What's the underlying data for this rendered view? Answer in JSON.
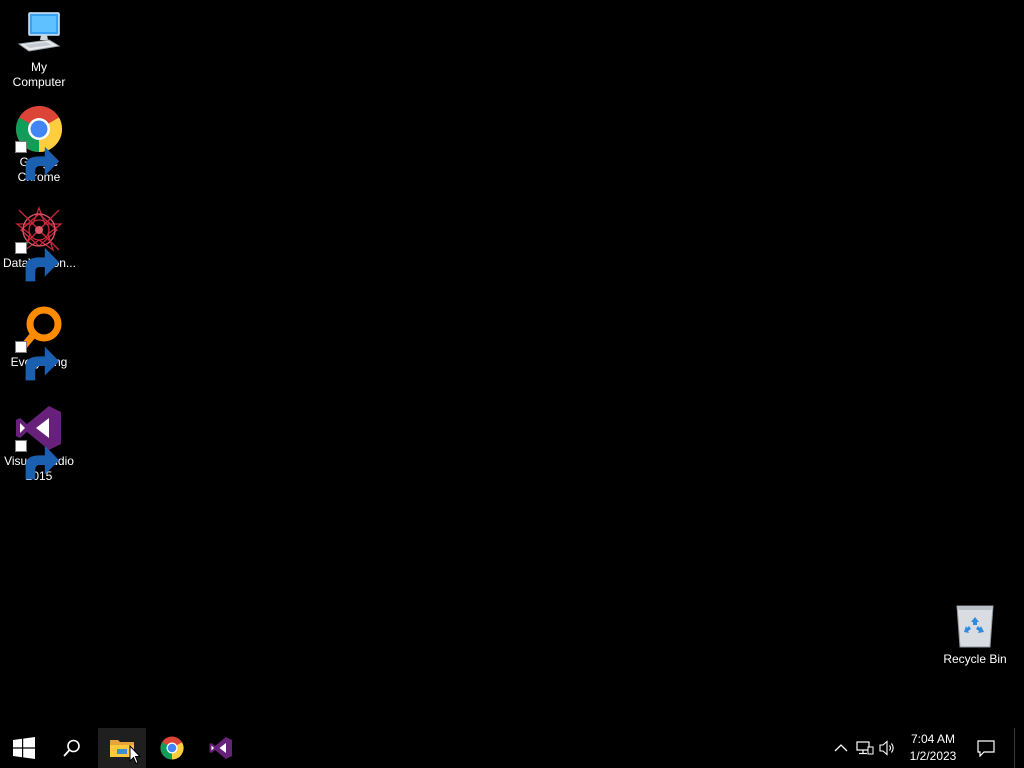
{
  "desktop": {
    "icons": [
      {
        "label": "My Computer",
        "icon": "computer-icon"
      },
      {
        "label": "Google Chrome",
        "icon": "chrome-icon",
        "shortcut": true
      },
      {
        "label": "DataWagon...",
        "icon": "datawagon-icon",
        "shortcut": true
      },
      {
        "label": "Everything",
        "icon": "everything-search-icon",
        "shortcut": true
      },
      {
        "label": "Visual Studio 2015",
        "icon": "visual-studio-icon",
        "shortcut": true
      },
      {
        "label": "Recycle Bin",
        "icon": "recycle-bin-icon"
      }
    ]
  },
  "taskbar": {
    "buttons": [
      {
        "name": "start",
        "icon": "windows-logo-icon"
      },
      {
        "name": "search",
        "icon": "search-icon"
      },
      {
        "name": "file-explorer",
        "icon": "folder-icon",
        "active": true
      },
      {
        "name": "chrome",
        "icon": "chrome-icon"
      },
      {
        "name": "visual-studio",
        "icon": "visual-studio-icon"
      }
    ],
    "tray": {
      "icons": [
        "chevron-up-icon",
        "network-icon",
        "volume-icon"
      ],
      "time": "7:04 AM",
      "date": "1/2/2023"
    }
  },
  "colors": {
    "background": "#000000",
    "vs_purple": "#68217a",
    "everything_orange": "#ff8c00"
  }
}
